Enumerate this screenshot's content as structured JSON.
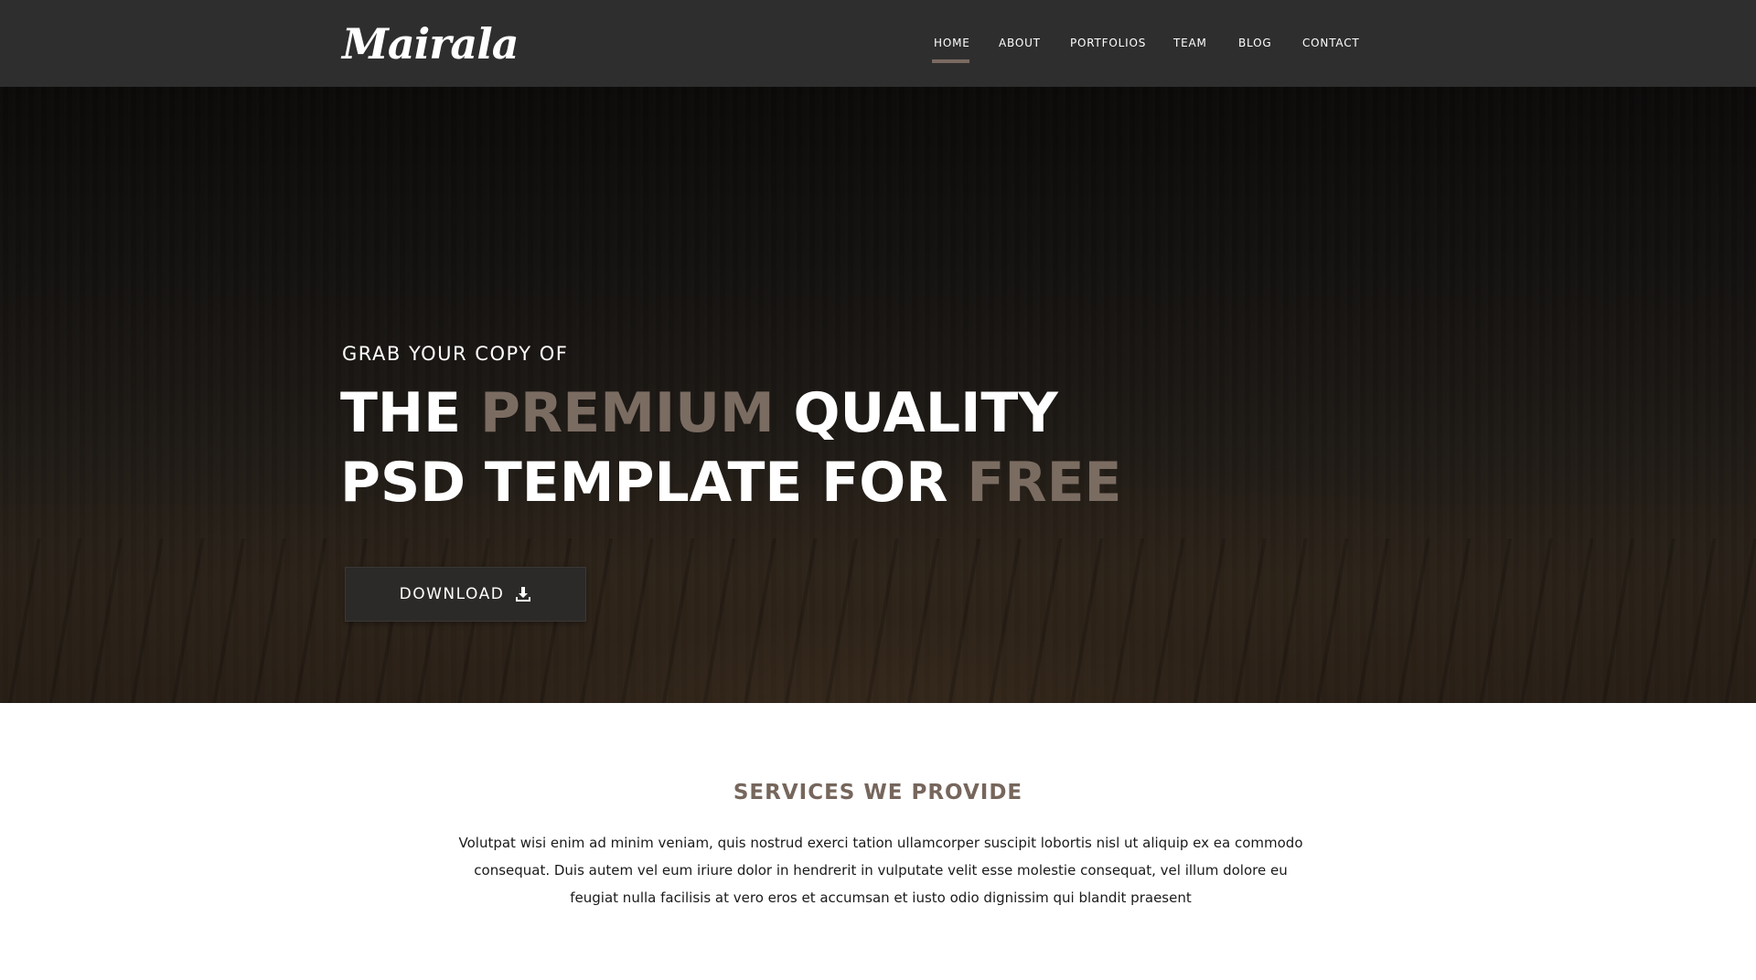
{
  "brand": {
    "logo_text": "Mairala"
  },
  "nav": {
    "items": [
      {
        "label": "HOME",
        "active": true
      },
      {
        "label": "ABOUT",
        "active": false
      },
      {
        "label": "PORTFOLIOS",
        "active": false
      },
      {
        "label": "TEAM",
        "active": false
      },
      {
        "label": "BLOG",
        "active": false
      },
      {
        "label": "CONTACT",
        "active": false
      }
    ]
  },
  "hero": {
    "kicker": "GRAB YOUR COPY OF",
    "line1": {
      "part1": "THE ",
      "accent": "PREMIUM",
      "part2": " QUALITY"
    },
    "line2": {
      "part1": "PSD TEMPLATE FOR ",
      "accent": "FREE"
    },
    "button_label": "DOWNLOAD",
    "button_icon": "download-icon"
  },
  "services": {
    "title": "SERVICES WE PROVIDE",
    "description": "Volutpat wisi enim ad minim veniam, quis nostrud exerci tation ullamcorper suscipit lobortis nisl ut aliquip ex ea commodo consequat. Duis autem vel eum iriure dolor in hendrerit in vulputate velit esse molestie consequat, vel illum dolore eu feugiat nulla facilisis at vero eros et accumsan et iusto odio dignissim qui blandit praesent"
  },
  "colors": {
    "navbar_bg": "#2e2e2e",
    "accent": "#7b6c62",
    "services_title": "#76665c",
    "button_bg": "#2b2a28"
  }
}
